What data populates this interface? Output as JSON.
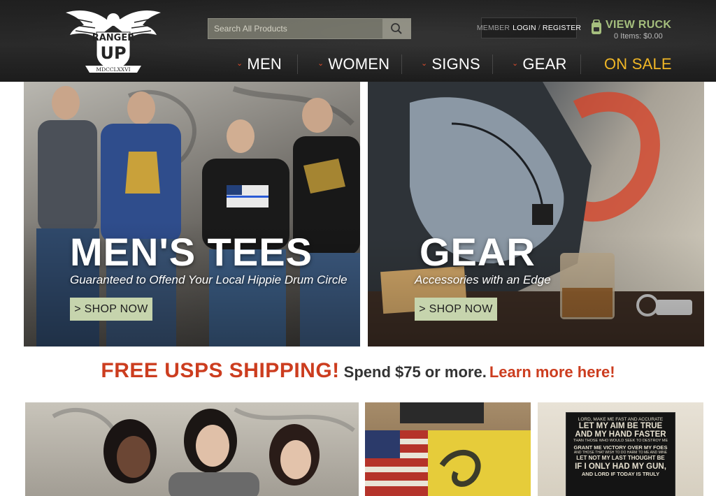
{
  "logo": {
    "line1": "RANGER",
    "line2": "UP",
    "roman": "MDCCLXXVI"
  },
  "search": {
    "placeholder": "Search All Products"
  },
  "account": {
    "prefix": "MEMBER",
    "login": "LOGIN",
    "separator": "/",
    "register": "REGISTER"
  },
  "ruck": {
    "title": "VIEW RUCK",
    "items": "0 Items: $0.00"
  },
  "nav": {
    "items": [
      {
        "label": "MEN"
      },
      {
        "label": "WOMEN"
      },
      {
        "label": "SIGNS"
      },
      {
        "label": "GEAR"
      }
    ],
    "sale": "ON SALE"
  },
  "hero": {
    "left": {
      "title": "MEN'S TEES",
      "subtitle": "Guaranteed to Offend Your Local Hippie Drum Circle",
      "button": "> SHOP NOW"
    },
    "right": {
      "title": "GEAR",
      "subtitle": "Accessories with an Edge",
      "button": "> SHOP NOW"
    }
  },
  "shipping": {
    "main": "FREE USPS SHIPPING!",
    "sub": "Spend $75 or more.",
    "link": "Learn more here!"
  },
  "sign": {
    "lines": [
      "LORD, MAKE ME FAST AND ACCURATE",
      "LET MY AIM BE TRUE",
      "AND MY HAND FASTER",
      "THAN THOSE WHO WOULD SEEK TO DESTROY ME",
      "GRANT ME VICTORY OVER MY FOES",
      "AND THOSE THAT WISH TO DO HARM TO ME AND MINE",
      "LET NOT MY LAST THOUGHT BE",
      "IF I ONLY HAD MY GUN,",
      "AND LORD IF TODAY IS TRULY"
    ]
  },
  "colors": {
    "accent_red": "#cc3d1f",
    "sale_gold": "#f0b624",
    "ruck_green": "#a3bd7a",
    "button_green": "#c6d4ad",
    "header_dark": "#222222"
  }
}
